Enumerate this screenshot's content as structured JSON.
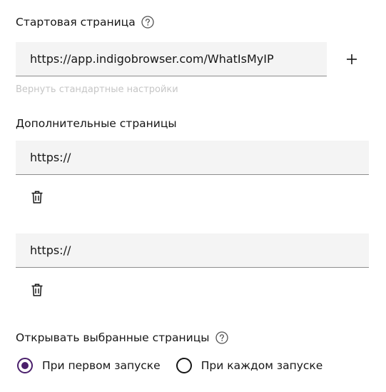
{
  "start_page": {
    "label": "Стартовая страница",
    "help_icon": "question-circle-icon",
    "url_value": "https://app.indigobrowser.com/WhatIsMyIP",
    "add_icon": "plus-icon",
    "reset_label": "Вернуть стандартные настройки"
  },
  "additional_pages": {
    "label": "Дополнительные страницы",
    "items": [
      {
        "value": "https://",
        "delete_icon": "trash-icon"
      },
      {
        "value": "https://",
        "delete_icon": "trash-icon"
      }
    ]
  },
  "open_pages": {
    "label": "Открывать выбранные страницы",
    "help_icon": "question-circle-icon",
    "options": [
      {
        "label": "При первом запуске",
        "checked": true
      },
      {
        "label": "При каждом запуске",
        "checked": false
      }
    ],
    "accent_color": "#4a1f6b"
  }
}
